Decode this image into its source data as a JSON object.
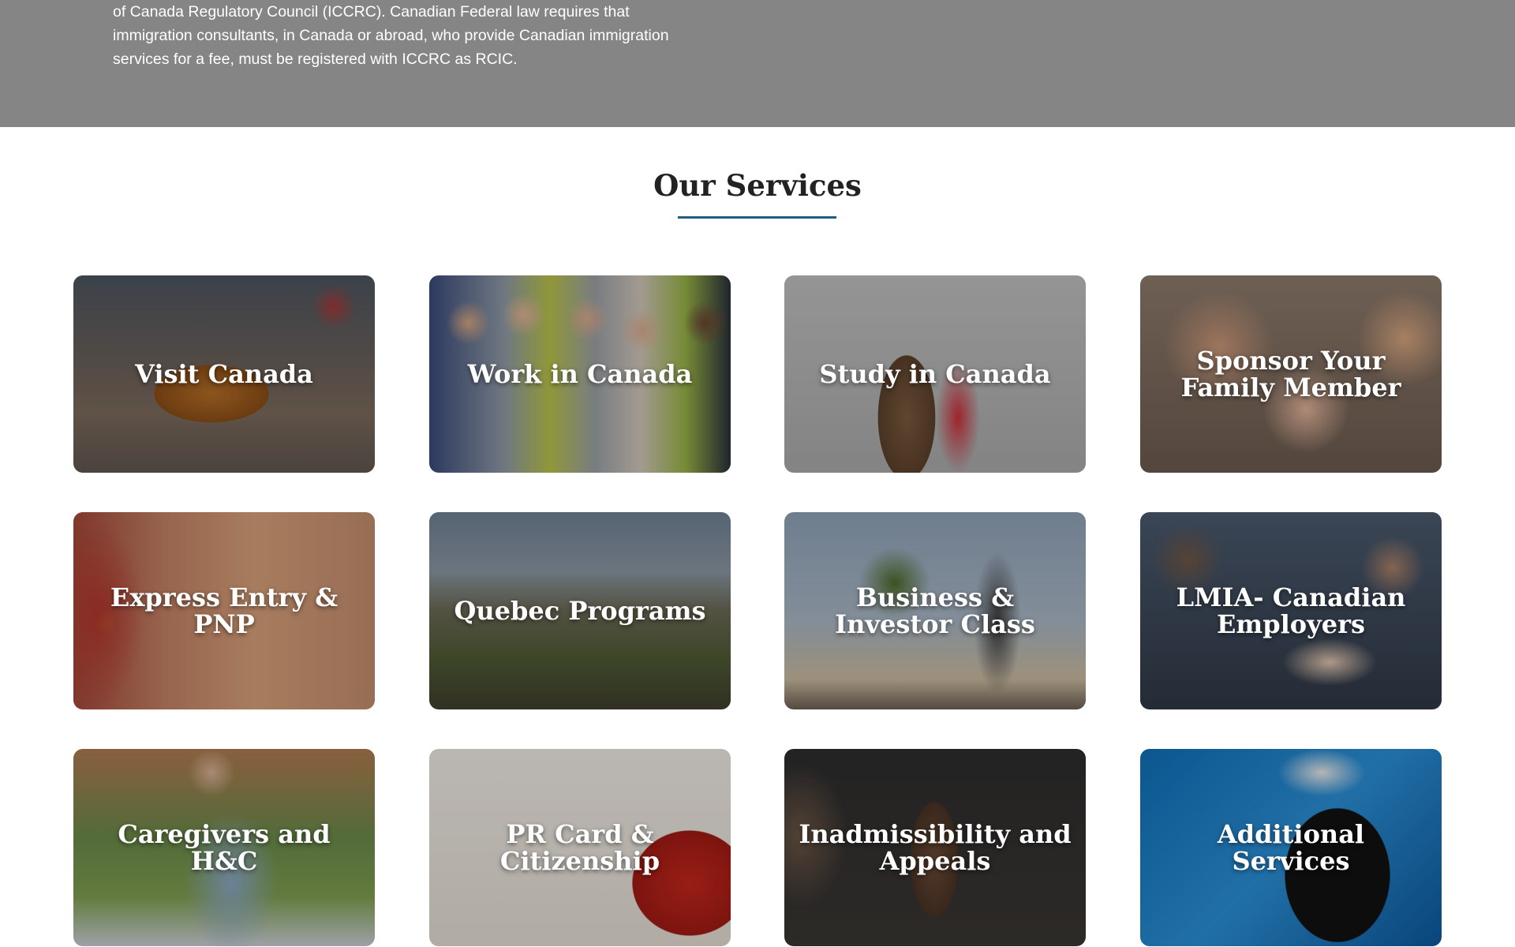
{
  "intro": {
    "lines": [
      "of Canada Regulatory Council (ICCRC). Canadian Federal law requires that",
      "immigration consultants, in Canada or abroad, who provide Canadian immigration",
      "services for a fee, must be registered with ICCRC as RCIC."
    ]
  },
  "services": {
    "title": "Our Services",
    "accent_color": "#1f5f86",
    "cards": [
      {
        "label": "Visit Canada"
      },
      {
        "label": "Work in Canada"
      },
      {
        "label": "Study in Canada"
      },
      {
        "label": "Sponsor Your Family Member"
      },
      {
        "label": "Express Entry & PNP"
      },
      {
        "label": "Quebec Programs"
      },
      {
        "label": "Business & Investor Class"
      },
      {
        "label": "LMIA- Canadian Employers"
      },
      {
        "label": "Caregivers and H&C"
      },
      {
        "label": "PR Card & Citizenship"
      },
      {
        "label": "Inadmissibility and Appeals"
      },
      {
        "label": "Additional Services"
      }
    ]
  }
}
